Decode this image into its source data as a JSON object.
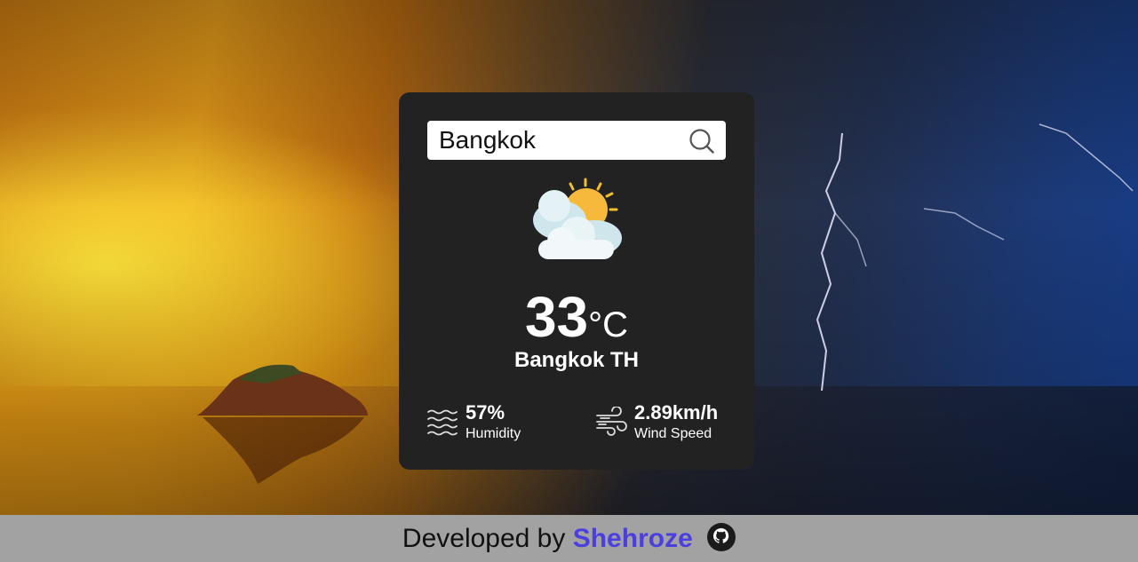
{
  "search": {
    "value": "Bangkok",
    "icon": "search-icon"
  },
  "weather": {
    "icon": "partly-cloudy-sun-icon",
    "temperature": "33",
    "unit": "°C",
    "location": "Bangkok TH"
  },
  "humidity": {
    "icon": "waves-icon",
    "value": "57%",
    "label": "Humidity"
  },
  "wind": {
    "icon": "wind-icon",
    "value": "2.89km/h",
    "label": "Wind Speed"
  },
  "footer": {
    "prefix": "Developed by",
    "author": "Shehroze",
    "icon": "github-icon"
  },
  "colors": {
    "card": "#222223",
    "footer": "#a2a2a2",
    "author_link": "#4c3fe0"
  }
}
